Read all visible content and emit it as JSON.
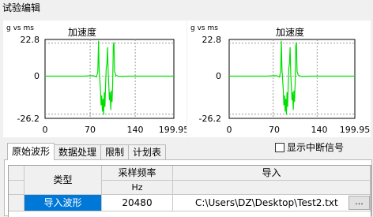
{
  "window": {
    "title": "试验编辑"
  },
  "charts": [
    {
      "unit_label": "g vs ms",
      "title": "加速度",
      "y_ticks": [
        "22.8",
        "0",
        "-26.2"
      ],
      "x_ticks": [
        "0",
        "70",
        "140",
        "199.95"
      ]
    },
    {
      "unit_label": "g vs ms",
      "title": "加速度",
      "y_ticks": [
        "22.8",
        "0",
        "-26.2"
      ],
      "x_ticks": [
        "0",
        "70",
        "140",
        "199.95"
      ]
    }
  ],
  "chart_data": [
    {
      "type": "line",
      "title": "加速度",
      "ylabel": "g vs ms",
      "xlim": [
        0,
        199.95
      ],
      "ylim": [
        -26.2,
        22.8
      ],
      "series": [
        {
          "color": "#00e000",
          "x": [
            0,
            60,
            75,
            80,
            82,
            83,
            84,
            85,
            86,
            87,
            88,
            89,
            90,
            91,
            92,
            93,
            94,
            95,
            96,
            97,
            98,
            99,
            100,
            101,
            102,
            103,
            104,
            105,
            106,
            107,
            108,
            110,
            115,
            130,
            199.95
          ],
          "y": [
            0,
            0,
            0.3,
            -0.5,
            3,
            22,
            4,
            -2,
            -8,
            -18,
            -12,
            -22,
            -14,
            -24,
            -10,
            -19,
            -6,
            5,
            8,
            18,
            2,
            -6,
            -15,
            -10,
            -21,
            -9,
            -16,
            -4,
            19,
            21,
            3,
            0.5,
            -0.2,
            0,
            0
          ]
        }
      ]
    },
    {
      "type": "line",
      "title": "加速度",
      "ylabel": "g vs ms",
      "xlim": [
        0,
        199.95
      ],
      "ylim": [
        -26.2,
        22.8
      ],
      "series": [
        {
          "color": "#00e000",
          "x": [
            0,
            60,
            75,
            80,
            82,
            83,
            84,
            85,
            86,
            87,
            88,
            89,
            90,
            91,
            92,
            93,
            94,
            95,
            96,
            97,
            98,
            99,
            100,
            101,
            102,
            103,
            104,
            105,
            106,
            107,
            108,
            110,
            115,
            130,
            199.95
          ],
          "y": [
            0,
            0,
            0.3,
            -0.5,
            3,
            22,
            4,
            -2,
            -8,
            -18,
            -12,
            -22,
            -14,
            -24,
            -10,
            -19,
            -6,
            5,
            8,
            18,
            2,
            -6,
            -15,
            -10,
            -21,
            -9,
            -16,
            -4,
            19,
            21,
            3,
            0.5,
            -0.2,
            0,
            0
          ]
        }
      ]
    }
  ],
  "tabs": [
    {
      "label": "原始波形",
      "active": true
    },
    {
      "label": "数据处理",
      "active": false
    },
    {
      "label": "限制",
      "active": false
    },
    {
      "label": "计划表",
      "active": false
    }
  ],
  "options": {
    "show_interrupt_label": "显示中断信号",
    "show_interrupt_checked": false
  },
  "table": {
    "headers": {
      "type": "类型",
      "sample_rate": "采样频率",
      "import": "导入"
    },
    "units": {
      "sample_rate": "Hz"
    },
    "rows": [
      {
        "type": "导入波形",
        "sample_rate": "20480",
        "path": "C:\\Users\\DZ\\Desktop\\Test2.txt",
        "browse": "..."
      }
    ]
  }
}
